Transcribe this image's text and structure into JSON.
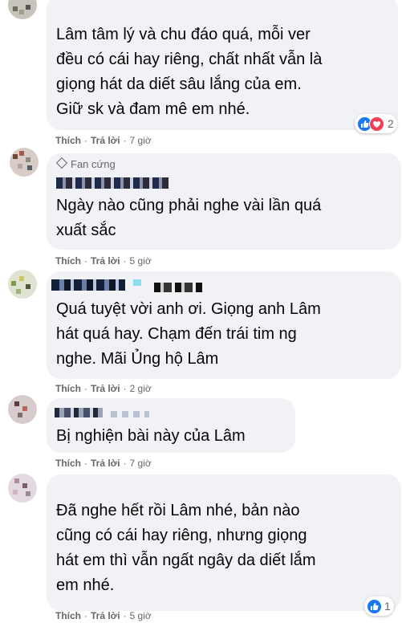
{
  "comments": [
    {
      "text": "Lâm tâm lý và chu đáo quá, mỗi ver\nđều có cái hay riêng, chất nhất vẫn là\ngiọng hát da diết sâu lắng của em.\nGiữ sk và đam mê em nhé.",
      "like_label": "Thích",
      "reply_label": "Trả lời",
      "time": "7 giờ",
      "reaction_count": "2"
    },
    {
      "badge": "Fan cứng",
      "text": "Ngày nào cũng phải nghe vài lần quá\nxuất sắc",
      "like_label": "Thích",
      "reply_label": "Trả lời",
      "time": "5 giờ"
    },
    {
      "text": "Quá tuyệt vời anh ơi. Giọng anh Lâm\nhát quá hay. Chạm đến trái tim ng\nnghe. Mãi Ủng hộ Lâm",
      "like_label": "Thích",
      "reply_label": "Trả lời",
      "time": "2 giờ"
    },
    {
      "text": "Bị nghiện bài này của Lâm",
      "like_label": "Thích",
      "reply_label": "Trả lời",
      "time": "7 giờ"
    },
    {
      "text": "Đã nghe hết rồi Lâm nhé, bản nào\ncũng có cái hay riêng, nhưng giọng\nhát em thì vẫn ngất ngây da diết lắm\nem nhé.",
      "like_label": "Thích",
      "reply_label": "Trả lời",
      "time": "5 giờ",
      "reaction_count": "1"
    }
  ],
  "colors": {
    "bubble": "#f0f2f5",
    "meta": "#65676b",
    "like": "#1877f2",
    "love": "#f33e58"
  },
  "icons": [
    "like-reaction-icon",
    "love-reaction-icon",
    "fan-badge-icon"
  ]
}
